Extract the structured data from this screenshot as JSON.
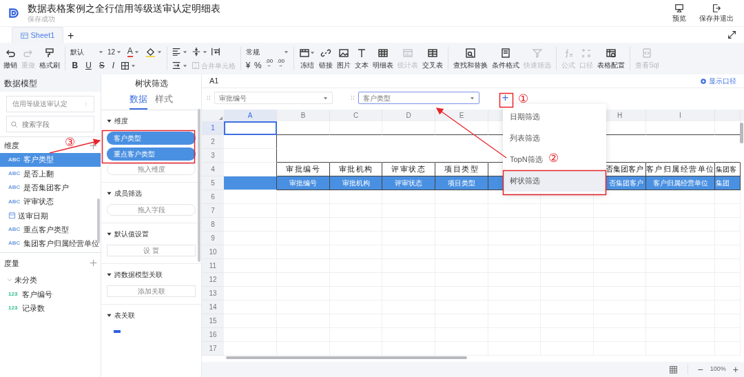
{
  "header": {
    "title": "数据表格案例之全行信用等级送审认定明细表",
    "subtitle": "保存成功",
    "actions": [
      {
        "label": "预览"
      },
      {
        "label": "保存并退出"
      }
    ]
  },
  "sheet_tabs": [
    {
      "label": "Sheet1",
      "selected": true
    }
  ],
  "add_sheet": "+",
  "toolbar": {
    "history": [
      {
        "label": "撤销",
        "disabled": false
      },
      {
        "label": "重做",
        "disabled": true
      },
      {
        "label": "格式刷",
        "disabled": false
      }
    ],
    "font_family": "默认",
    "font_size": "12",
    "font_color_glyph": "A",
    "styles": [
      "B",
      "U",
      "S",
      "I"
    ],
    "merge": {
      "label": "合并单元格",
      "disabled": true
    },
    "number_format": "常规",
    "number_buttons": [
      "¥",
      "%",
      ".00",
      ".00"
    ],
    "tool_groups": [
      [
        {
          "label": "冻结",
          "disabled": false
        },
        {
          "label": "链接",
          "disabled": false
        },
        {
          "label": "图片",
          "disabled": false
        },
        {
          "label": "文本",
          "disabled": false
        },
        {
          "label": "明细表",
          "disabled": false
        },
        {
          "label": "统计表",
          "disabled": true
        },
        {
          "label": "交叉表",
          "disabled": false
        }
      ],
      [
        {
          "label": "查找和替换",
          "disabled": false
        },
        {
          "label": "条件格式",
          "disabled": false
        },
        {
          "label": "快速筛选",
          "disabled": true
        }
      ],
      [
        {
          "label": "公式",
          "disabled": true
        },
        {
          "label": "口径",
          "disabled": true
        },
        {
          "label": "表格配置",
          "disabled": false
        }
      ],
      [
        {
          "label": "查看Sql",
          "disabled": true
        }
      ]
    ]
  },
  "model_panel": {
    "title": "数据模型",
    "model": "信用等级送审认定",
    "search_placeholder": "搜索字段",
    "dimensions": {
      "title": "维度",
      "items": [
        {
          "kind": "field",
          "badge": "ABC",
          "label": "客户类型",
          "selected": true
        },
        {
          "kind": "field",
          "badge": "ABC",
          "label": "是否上翻",
          "selected": false
        },
        {
          "kind": "field",
          "badge": "ABC",
          "label": "是否集团客户",
          "selected": false
        },
        {
          "kind": "field",
          "badge": "ABC",
          "label": "评审状态",
          "selected": false
        },
        {
          "kind": "date",
          "label": "送审日期",
          "selected": false
        },
        {
          "kind": "field",
          "badge": "ABC",
          "label": "重点客户类型",
          "selected": false
        },
        {
          "kind": "field",
          "badge": "ABC",
          "label": "集团客户归属经营单位",
          "selected": false
        }
      ]
    },
    "measures": {
      "title": "度量",
      "groups": [
        {
          "label": "未分类",
          "expanded": true,
          "children": [
            {
              "badge": "123",
              "label": "客户编号"
            },
            {
              "badge": "123",
              "label": "记录数"
            }
          ]
        }
      ]
    }
  },
  "filter_panel": {
    "title": "树状筛选",
    "tabs": [
      {
        "label": "数据",
        "selected": true
      },
      {
        "label": "样式",
        "selected": false
      }
    ],
    "sections": [
      {
        "title": "维度",
        "pills": [
          "客户类型",
          "重点客户类型"
        ],
        "button": "拖入维度",
        "kind": "pill"
      },
      {
        "title": "成员筛选",
        "button": "拖入字段",
        "kind": "pill"
      },
      {
        "title": "默认值设置",
        "button": "设 置",
        "kind": "box"
      },
      {
        "title": "跨数据模型关联",
        "button": "添加关联",
        "kind": "box"
      },
      {
        "title": "表关联",
        "select_all_checked": true,
        "kind": "check"
      }
    ]
  },
  "sheet": {
    "cell_ref": "A1",
    "caliber_link": "显示口径",
    "filters": [
      {
        "placeholder": "审批编号",
        "focused": false
      },
      {
        "placeholder": "客户类型",
        "focused": true
      }
    ],
    "add_filter": "+",
    "columns_left": [
      {
        "label": "A",
        "selected": true
      },
      {
        "label": "B",
        "selected": false
      },
      {
        "label": "C",
        "selected": false
      },
      {
        "label": "D",
        "selected": false
      },
      {
        "label": "E",
        "selected": false
      }
    ],
    "columns_right": [
      {
        "label": "H",
        "selected": false
      },
      {
        "label": "I",
        "selected": false
      }
    ],
    "rows": [
      {
        "label": "1",
        "selected": true
      },
      {
        "label": "2",
        "selected": false
      },
      {
        "label": "3",
        "selected": false
      },
      {
        "label": "4",
        "selected": false
      },
      {
        "label": "5",
        "selected": false
      },
      {
        "label": "6",
        "selected": false
      },
      {
        "label": "7",
        "selected": false
      },
      {
        "label": "8",
        "selected": false
      },
      {
        "label": "9",
        "selected": false
      },
      {
        "label": "10",
        "selected": false
      },
      {
        "label": "11",
        "selected": false
      },
      {
        "label": "12",
        "selected": false
      },
      {
        "label": "13",
        "selected": false
      },
      {
        "label": "14",
        "selected": false
      },
      {
        "label": "15",
        "selected": false
      },
      {
        "label": "16",
        "selected": false
      },
      {
        "label": "17",
        "selected": false
      }
    ],
    "title_row": {
      "left": [
        "审批编号",
        "审批机构",
        "评审状态",
        "项目类型"
      ],
      "right": [
        "否集团客户",
        "客户归属经营单位",
        "集团客"
      ]
    },
    "field_row": {
      "left": [
        "审批编号",
        "审批机构",
        "评审状态",
        "项目类型"
      ],
      "right": [
        "否集团客户",
        "客户归属经营单位",
        "集团"
      ]
    },
    "zoom": "100%",
    "zoom_out": "−",
    "zoom_in": "+"
  },
  "filter_menu": [
    {
      "label": "日期筛选",
      "highlighted": false
    },
    {
      "label": "列表筛选",
      "highlighted": false
    },
    {
      "label": "TopN筛选",
      "highlighted": false
    },
    {
      "label": "树状筛选",
      "highlighted": true
    }
  ],
  "annotations": [
    {
      "label": "①"
    },
    {
      "label": "②"
    },
    {
      "label": "③"
    }
  ]
}
